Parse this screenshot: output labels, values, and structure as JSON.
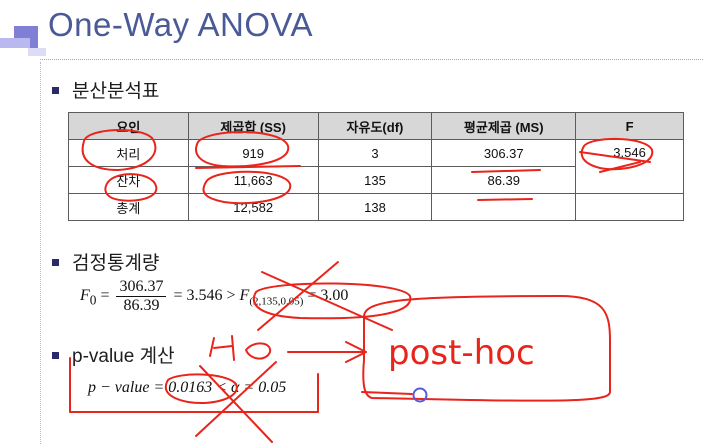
{
  "slide": {
    "title": "One-Way  ANOVA",
    "accent_color": "#4a5a96",
    "bullet_color": "#2a2a6a"
  },
  "sections": {
    "anova_table": "분산분석표",
    "test_statistic": "검정통계량",
    "pvalue": "p-value 계산"
  },
  "table": {
    "headers": [
      "요인",
      "제곱합 (SS)",
      "자유도(df)",
      "평균제곱 (MS)",
      "F"
    ],
    "rows": [
      [
        "처리",
        "919",
        "3",
        "306.37",
        "3.546"
      ],
      [
        "잔차",
        "11,663",
        "135",
        "86.39",
        ""
      ],
      [
        "총계",
        "12,582",
        "138",
        "",
        ""
      ]
    ]
  },
  "formula_test": {
    "lhs": "F",
    "lhs_sub": "0",
    "eq1": " = ",
    "num": "306.37",
    "den": "86.39",
    "mid": " = 3.546 > ",
    "crit": "F",
    "crit_sub": "(2,135,0.05)",
    "rhs": " = 3.00"
  },
  "formula_pvalue": {
    "text": "p − value = 0.0163 < α = 0.05"
  },
  "annotation": {
    "text": "post-hoc",
    "ink_color": "#e8241b",
    "cursor_color": "#5a5ad8"
  }
}
